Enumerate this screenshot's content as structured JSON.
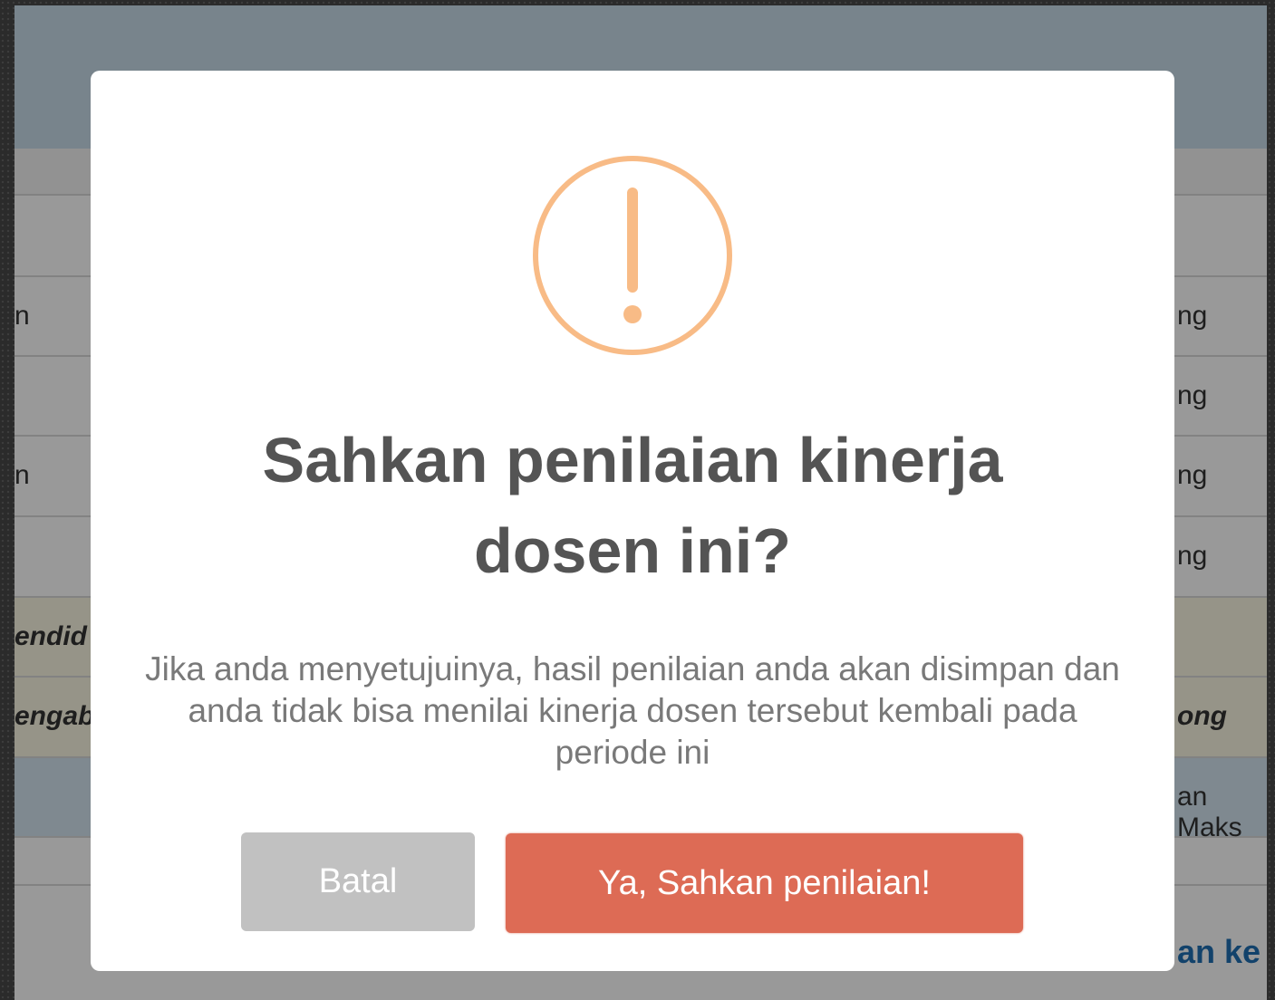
{
  "background": {
    "rows": [
      {
        "left": "",
        "right": ""
      },
      {
        "left": "",
        "right": ""
      },
      {
        "left": "n",
        "right": "ng"
      },
      {
        "left": "",
        "right": "ng"
      },
      {
        "left": "n",
        "right": "ng"
      },
      {
        "left": "",
        "right": "ng"
      },
      {
        "left": "endid",
        "right": ""
      },
      {
        "left": "engab",
        "right": "ong"
      },
      {
        "left": "",
        "right": "an Maks"
      },
      {
        "left": "",
        "right": ""
      },
      {
        "left": "",
        "right": "an ke"
      }
    ]
  },
  "modal": {
    "icon": "warning-exclamation-icon",
    "icon_color": "#f8bb86",
    "title_line1": "Sahkan penilaian kinerja",
    "title_line2": "dosen ini?",
    "text": "Jika anda menyetujuinya, hasil penilaian anda akan disimpan dan anda tidak bisa menilai kinerja dosen tersebut kembali pada periode ini",
    "cancel_label": "Batal",
    "confirm_label": "Ya, Sahkan penilaian!",
    "cancel_color": "#c1c1c1",
    "confirm_color": "#dd6b55"
  }
}
